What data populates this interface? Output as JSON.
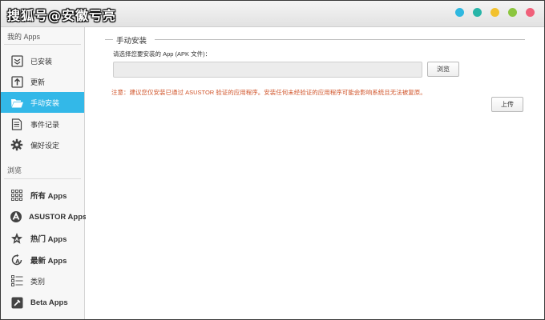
{
  "watermark": "搜狐号@安徽亏亮",
  "window_controls": [
    {
      "name": "control-blue",
      "color": "#2fb8e0"
    },
    {
      "name": "control-teal",
      "color": "#28b5a8"
    },
    {
      "name": "control-yellow",
      "color": "#f2c12e"
    },
    {
      "name": "control-green",
      "color": "#8cc63f"
    },
    {
      "name": "control-red",
      "color": "#f0607a"
    }
  ],
  "sidebar": {
    "section_my_apps": "我的 Apps",
    "my_apps": [
      {
        "label": "已安装",
        "icon": "installed-icon"
      },
      {
        "label": "更新",
        "icon": "update-icon"
      },
      {
        "label": "手动安装",
        "icon": "folder-open-icon",
        "active": true
      },
      {
        "label": "事件记录",
        "icon": "log-icon"
      },
      {
        "label": "偏好设定",
        "icon": "gear-icon"
      }
    ],
    "section_browse": "浏览",
    "browse": [
      {
        "label": "所有 Apps",
        "icon": "grid-icon"
      },
      {
        "label": "ASUSTOR Apps",
        "icon": "asustor-icon"
      },
      {
        "label": "热门 Apps",
        "icon": "star-icon"
      },
      {
        "label": "最新 Apps",
        "icon": "new-apps-icon"
      },
      {
        "label": "类别",
        "icon": "list-icon"
      },
      {
        "label": "Beta Apps",
        "icon": "beta-icon"
      }
    ]
  },
  "main": {
    "section_title": "手动安装",
    "prompt": "请选择您要安装的 App (APK 文件)：",
    "file_value": "",
    "browse_label": "浏览",
    "warning": "注意：建议您仅安装已通过 ASUSTOR 验证的应用程序。安装任何未经验证的应用程序可能会影响系统且无法被复原。",
    "upload_label": "上传"
  },
  "colors": {
    "accent": "#33b8e8",
    "warning": "#d0542a"
  }
}
